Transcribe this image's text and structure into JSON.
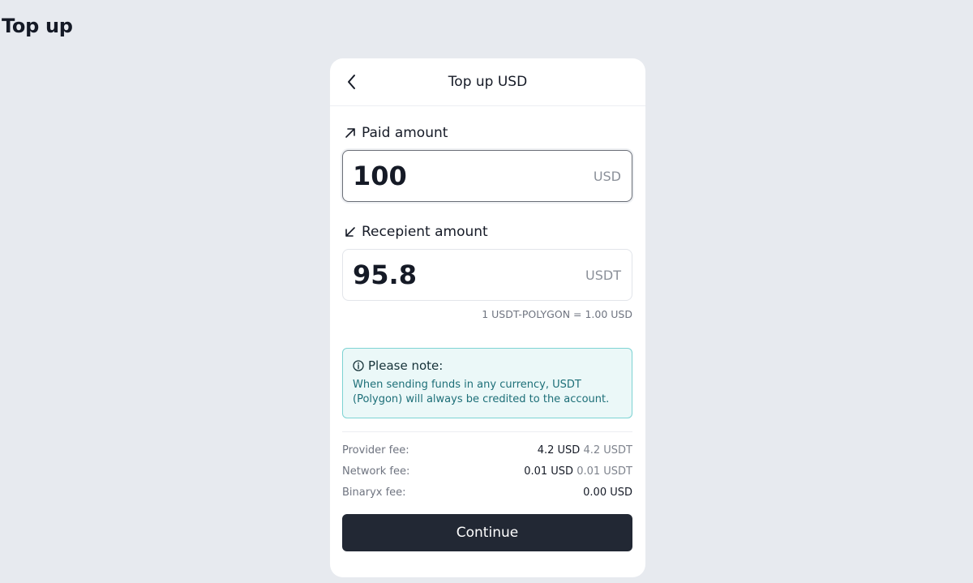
{
  "page": {
    "title": "Top up"
  },
  "card": {
    "title": "Top up USD",
    "paid": {
      "label": "Paid amount",
      "value": "100",
      "currency": "USD"
    },
    "recipient": {
      "label": "Recepient amount",
      "value": "95.8",
      "currency": "USDT"
    },
    "rate": "1 USDT-POLYGON = 1.00 USD",
    "note": {
      "title": "Please note:",
      "text": "When sending funds in any currency, USDT (Polygon) will always be credited to the account."
    },
    "fees": [
      {
        "label": "Provider fee:",
        "value": "4.2 USD",
        "secondary": "4.2 USDT"
      },
      {
        "label": "Network fee:",
        "value": "0.01 USD",
        "secondary": "0.01 USDT"
      },
      {
        "label": "Binaryx fee:",
        "value": "0.00 USD",
        "secondary": ""
      }
    ],
    "continue_label": "Continue"
  },
  "icons": {
    "back": "chevron-left-icon",
    "paid": "arrow-up-right-icon",
    "recipient": "arrow-down-left-icon",
    "note": "info-icon"
  },
  "colors": {
    "background": "#e7eaef",
    "button": "#222834",
    "note_border": "#7dd3d3",
    "note_bg": "#ebf8f8",
    "note_text": "#1d6f78"
  }
}
